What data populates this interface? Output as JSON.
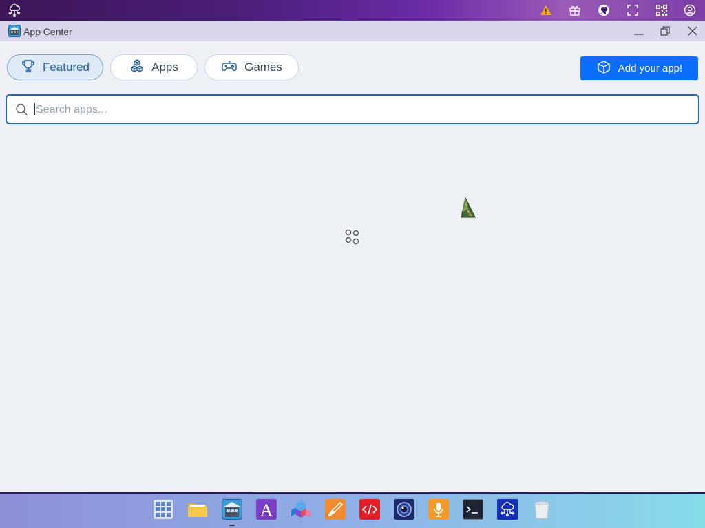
{
  "topbar": {
    "left_icon": "cloud-network-icon",
    "right_icons": [
      "warning-icon",
      "gift-icon",
      "github-icon",
      "fullscreen-icon",
      "qrcode-icon",
      "user-circle-icon"
    ]
  },
  "window": {
    "title": "App Center",
    "app_icon": "app-center-icon",
    "controls": [
      "minimize-icon",
      "maximize-icon",
      "close-icon"
    ]
  },
  "tabs": [
    {
      "label": "Featured",
      "icon": "trophy-icon",
      "active": true
    },
    {
      "label": "Apps",
      "icon": "cubes-icon",
      "active": false
    },
    {
      "label": "Games",
      "icon": "gamepad-icon",
      "active": false
    }
  ],
  "add_app_button": {
    "label": "Add your app!",
    "icon": "box-icon"
  },
  "search": {
    "placeholder": "Search apps...",
    "value": ""
  },
  "status": {
    "loading": true
  },
  "dock": {
    "items": [
      {
        "name": "app-launcher",
        "icon": "grid-icon"
      },
      {
        "name": "file-explorer",
        "icon": "folder-icon"
      },
      {
        "name": "app-center",
        "icon": "app-center-icon",
        "active": true
      },
      {
        "name": "font-app",
        "icon": "letter-a-icon"
      },
      {
        "name": "3d-cubes-app",
        "icon": "cubes-3d-icon"
      },
      {
        "name": "paint-app",
        "icon": "brush-icon"
      },
      {
        "name": "code-editor",
        "icon": "code-icon"
      },
      {
        "name": "camera-app",
        "icon": "camera-icon"
      },
      {
        "name": "recorder-app",
        "icon": "microphone-icon"
      },
      {
        "name": "terminal",
        "icon": "terminal-icon"
      },
      {
        "name": "network-app",
        "icon": "cloud-network-icon"
      },
      {
        "name": "trash",
        "icon": "trash-icon"
      }
    ]
  },
  "colors": {
    "accent": "#0d6efd",
    "active_tab_bg": "#dfeaf7",
    "background": "#eff0f5",
    "warning": "#f5b301"
  }
}
